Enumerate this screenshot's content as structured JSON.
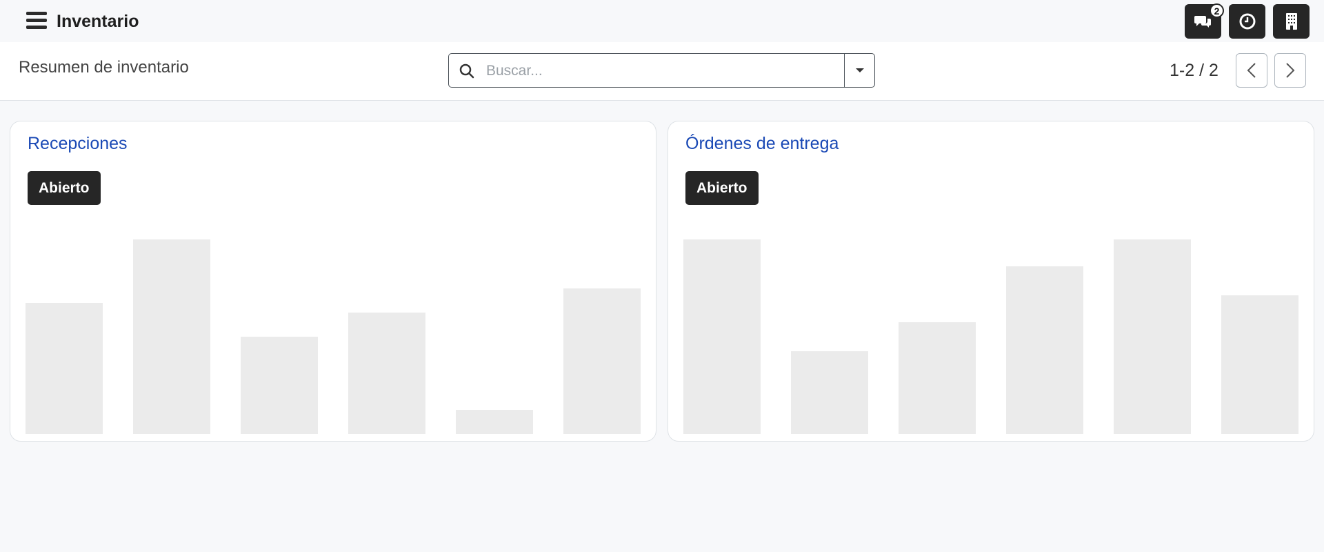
{
  "app": {
    "title": "Inventario"
  },
  "navbar": {
    "messages_badge": "2"
  },
  "control_panel": {
    "breadcrumb": "Resumen de inventario",
    "search_placeholder": "Buscar...",
    "pager": "1-2 / 2"
  },
  "cards": [
    {
      "title": "Recepciones",
      "button_label": "Abierto",
      "bar_values": [
        0.54,
        0.8,
        0.4,
        0.5,
        0.1,
        0.6
      ]
    },
    {
      "title": "Órdenes de entrega",
      "button_label": "Abierto",
      "bar_values": [
        0.8,
        0.34,
        0.46,
        0.69,
        0.8,
        0.57
      ]
    }
  ],
  "colors": {
    "accent_link": "#1a49b5",
    "button_dark": "#262626",
    "placeholder_bar": "#ebebeb"
  },
  "icons": [
    "menu-icon",
    "chat-icon",
    "clock-icon",
    "building-icon",
    "search-icon",
    "caret-down-icon",
    "chevron-left-icon",
    "chevron-right-icon"
  ]
}
